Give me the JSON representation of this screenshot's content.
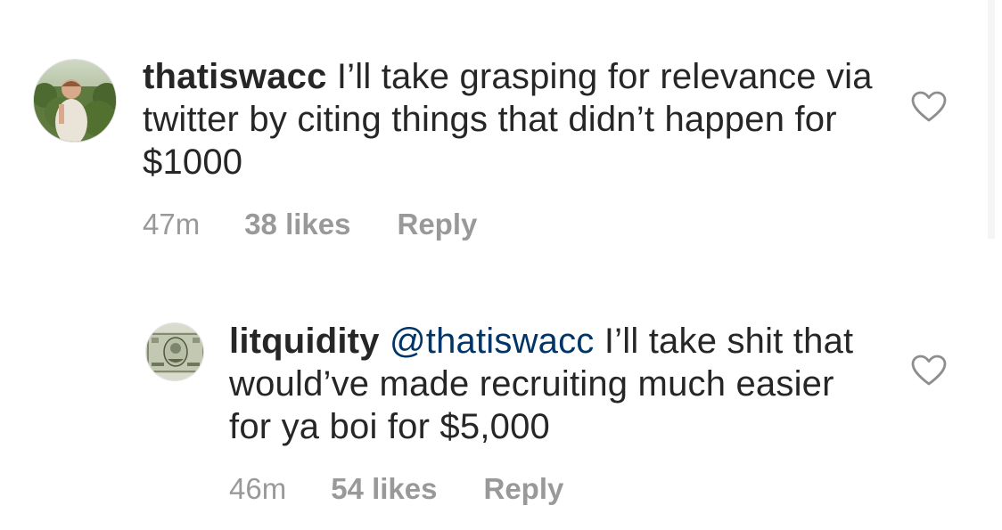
{
  "comments": [
    {
      "username": "thatiswacc",
      "mention": "",
      "text": "I’ll take grasping for relevance via twitter by citing things that didn’t happen for $1000",
      "time": "47m",
      "likes": "38 likes",
      "reply_label": "Reply",
      "avatar_icon": "user-avatar-photo",
      "like_icon": "heart-outline-icon"
    },
    {
      "username": "litquidity",
      "mention": "@thatiswacc",
      "text": "I’ll take shit that would’ve made recruiting much easier for ya boi for $5,000",
      "time": "46m",
      "likes": "54 likes",
      "reply_label": "Reply",
      "avatar_icon": "dollar-bill-avatar",
      "like_icon": "heart-outline-icon"
    }
  ],
  "colors": {
    "text": "#262626",
    "meta": "#999999",
    "mention": "#003569",
    "icon": "#8e8e8e"
  }
}
